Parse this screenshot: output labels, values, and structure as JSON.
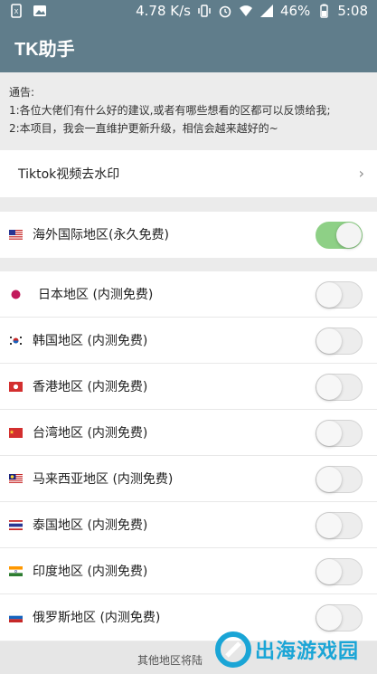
{
  "statusbar": {
    "network_speed": "4.78 K/s",
    "battery": "46%",
    "time": "5:08"
  },
  "appbar": {
    "title": "TK助手"
  },
  "notice": {
    "line1": "通告:",
    "line2": "1:各位大佬们有什么好的建议,或者有哪些想看的区都可以反馈给我;",
    "line3": "2:本项目，我会一直维护更新升级，相信会越来越好的~"
  },
  "tiktok_row": {
    "label": "Tiktok视频去水印",
    "chevron": "›"
  },
  "regions": [
    {
      "label": "海外国际地区(永久免费)",
      "flag": "us-flag-icon",
      "enabled": true
    },
    {
      "label": "日本地区 (内测免费)",
      "flag": "jp-flag-icon",
      "enabled": false
    },
    {
      "label": "韩国地区 (内测免费)",
      "flag": "kr-flag-icon",
      "enabled": false
    },
    {
      "label": "香港地区 (内测免费)",
      "flag": "hk-flag-icon",
      "enabled": false
    },
    {
      "label": "台湾地区 (内测免费)",
      "flag": "tw-flag-icon",
      "enabled": false
    },
    {
      "label": "马来西亚地区 (内测免费)",
      "flag": "my-flag-icon",
      "enabled": false
    },
    {
      "label": "泰国地区 (内测免费)",
      "flag": "th-flag-icon",
      "enabled": false
    },
    {
      "label": "印度地区 (内测免费)",
      "flag": "in-flag-icon",
      "enabled": false
    },
    {
      "label": "俄罗斯地区 (内测免费)",
      "flag": "ru-flag-icon",
      "enabled": false
    }
  ],
  "footer": {
    "text": "其他地区将陆"
  },
  "watermark": {
    "text": "出海游戏园"
  },
  "colors": {
    "appbar": "#607d8b",
    "toggle_on": "#8ed086",
    "watermark": "#1aa5d6"
  }
}
